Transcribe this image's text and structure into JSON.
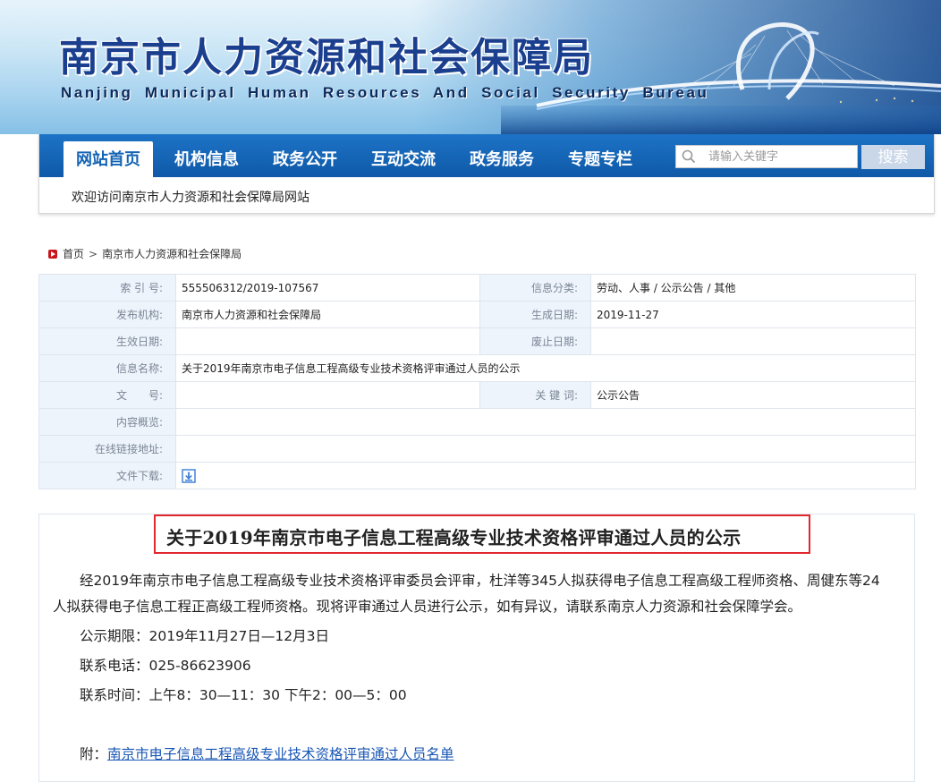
{
  "header": {
    "title_cn": "南京市人力资源和社会保障局",
    "title_en": "Nanjing Municipal Human Resources And Social Security Bureau"
  },
  "nav": {
    "items": [
      {
        "label": "网站首页",
        "active": true
      },
      {
        "label": "机构信息"
      },
      {
        "label": "政务公开"
      },
      {
        "label": "互动交流"
      },
      {
        "label": "政务服务"
      },
      {
        "label": "专题专栏"
      }
    ],
    "search_placeholder": "请输入关键字",
    "search_button": "搜索",
    "welcome": "欢迎访问南京市人力资源和社会保障局网站"
  },
  "breadcrumb": {
    "home": "首页",
    "current": "南京市人力资源和社会保障局",
    "separator": ">"
  },
  "info": {
    "index_label": "索 引 号:",
    "index_value": "555506312/2019-107567",
    "category_label": "信息分类:",
    "category_value": "劳动、人事 / 公示公告 / 其他",
    "publisher_label": "发布机构:",
    "publisher_value": "南京市人力资源和社会保障局",
    "generated_label": "生成日期:",
    "generated_value": "2019-11-27",
    "effective_label": "生效日期:",
    "effective_value": "",
    "repeal_label": "废止日期:",
    "repeal_value": "",
    "name_label": "信息名称:",
    "name_value": "关于2019年南京市电子信息工程高级专业技术资格评审通过人员的公示",
    "docno_label": "文　　号:",
    "docno_value": "",
    "keyword_label": "关 键 词:",
    "keyword_value": "公示公告",
    "summary_label": "内容概览:",
    "summary_value": "",
    "link_label": "在线链接地址:",
    "link_value": "",
    "download_label": "文件下载:"
  },
  "article": {
    "title": "关于2019年南京市电子信息工程高级专业技术资格评审通过人员的公示",
    "para1_line1": "经2019年南京市电子信息工程高级专业技术资格评审委员会评审，杜洋等345人拟获得电子信息工程高级工程师资格、周健东等24",
    "para1_line2": "人拟获得电子信息工程正高级工程师资格。现将评审通过人员进行公示，如有异议，请联系南京人力资源和社会保障学会。",
    "period": "公示期限：2019年11月27日—12月3日",
    "phone": "联系电话：025-86623906",
    "hours": "联系时间：上午8：30—11：30  下午2：00—5：00",
    "attach_prefix": "附：",
    "attach_link": "南京市电子信息工程高级专业技术资格评审通过人员名单"
  },
  "colors": {
    "nav_blue": "#1464b4",
    "title_blue": "#1b3f8f",
    "highlight_red": "#e0282e",
    "link_blue": "#1a57b5"
  }
}
